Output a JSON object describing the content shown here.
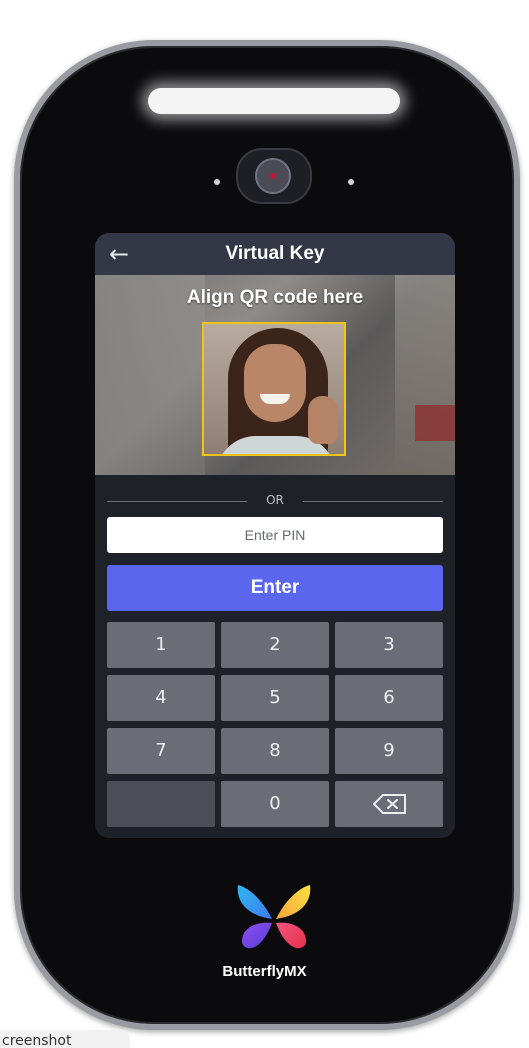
{
  "header": {
    "title": "Virtual Key",
    "back_icon": "arrow-left-icon"
  },
  "camera": {
    "instruction": "Align QR code here",
    "frame_color": "#f2c418"
  },
  "divider": {
    "text": "OR"
  },
  "pin": {
    "placeholder": "Enter PIN",
    "value": ""
  },
  "enter_button": {
    "label": "Enter",
    "color": "#5a66ee"
  },
  "keypad": {
    "keys": [
      "1",
      "2",
      "3",
      "4",
      "5",
      "6",
      "7",
      "8",
      "9",
      "",
      "0"
    ],
    "backspace_icon": "backspace-icon"
  },
  "brand": {
    "name": "ButterflyMX",
    "logo_icon": "butterfly-logo-icon"
  },
  "bottom_tab": {
    "label": "creenshot"
  }
}
